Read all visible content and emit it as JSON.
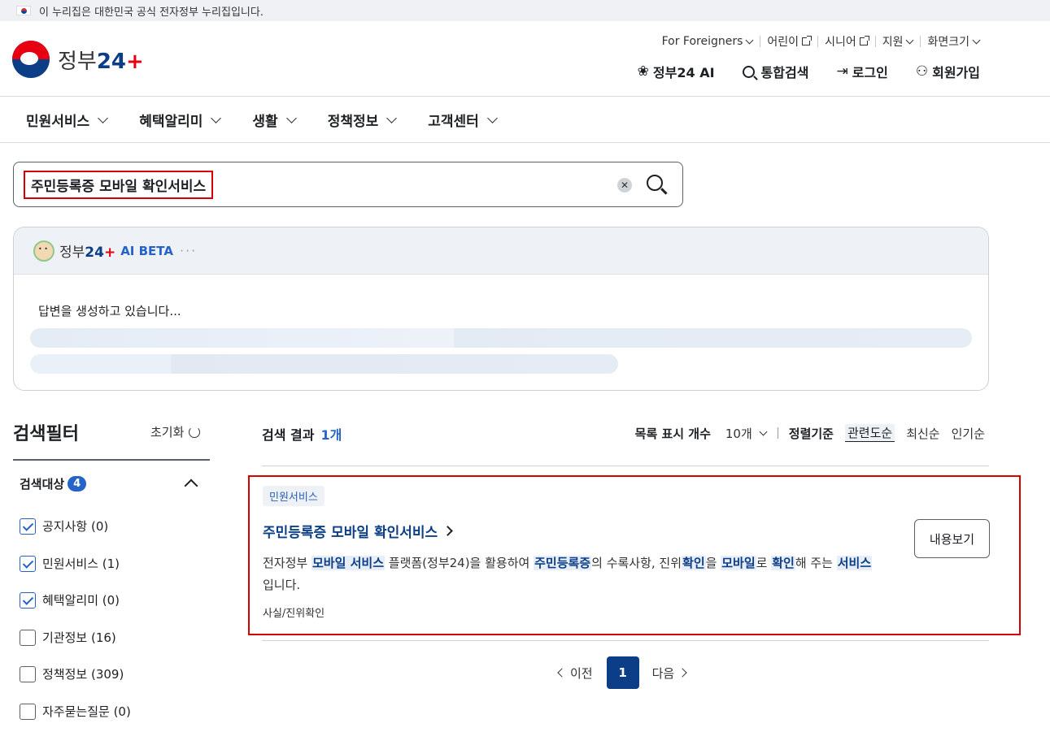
{
  "banner": {
    "text": "이 누리집은 대한민국 공식 전자정부 누리집입니다."
  },
  "logo": {
    "text_main": "정부",
    "text_num": "24",
    "text_plus": "+"
  },
  "util_nav": [
    {
      "label": "For Foreigners"
    },
    {
      "label": "어린이"
    },
    {
      "label": "시니어"
    },
    {
      "label": "지원"
    },
    {
      "label": "화면크기"
    }
  ],
  "main_util": {
    "ai": "정부24 AI",
    "search": "통합검색",
    "login": "로그인",
    "signup": "회원가입"
  },
  "gnb": [
    "민원서비스",
    "혜택알리미",
    "생활",
    "정책정보",
    "고객센터"
  ],
  "search": {
    "value": "주민등록증 모바일 확인서비스"
  },
  "ai_panel": {
    "brand_main": "정부",
    "brand_num": "24",
    "beta": "AI BETA",
    "dots": "···",
    "status": "답변을 생성하고 있습니다..."
  },
  "filter": {
    "title": "검색필터",
    "reset": "초기화",
    "target_label": "검색대상",
    "target_count": "4",
    "options": [
      {
        "label": "공지사항 (0)",
        "checked": true
      },
      {
        "label": "민원서비스 (1)",
        "checked": true
      },
      {
        "label": "혜택알리미 (0)",
        "checked": true
      },
      {
        "label": "기관정보 (16)",
        "checked": false
      },
      {
        "label": "정책정보 (309)",
        "checked": false
      },
      {
        "label": "자주묻는질문 (0)",
        "checked": false
      }
    ]
  },
  "results": {
    "title": "검색 결과",
    "count": "1개",
    "list_size_label": "목록 표시 개수",
    "list_size_value": "10개",
    "sort_label": "정렬기준",
    "sort_options": [
      "관련도순",
      "최신순",
      "인기순"
    ],
    "items": [
      {
        "tag": "민원서비스",
        "title": "주민등록증 모바일 확인서비스",
        "desc_parts": [
          {
            "t": "전자정부 ",
            "hl": false
          },
          {
            "t": "모바일 서비스",
            "hl": true
          },
          {
            "t": " 플랫폼(정부24)을 활용하여 ",
            "hl": false
          },
          {
            "t": "주민등록증",
            "hl": true
          },
          {
            "t": "의 수록사항, 진위",
            "hl": false
          },
          {
            "t": "확인",
            "hl": true
          },
          {
            "t": "을 ",
            "hl": false
          },
          {
            "t": "모바일",
            "hl": true
          },
          {
            "t": "로 ",
            "hl": false
          },
          {
            "t": "확인",
            "hl": true
          },
          {
            "t": "해 주는 ",
            "hl": false
          },
          {
            "t": "서비스",
            "hl": true
          },
          {
            "t": " 입니다.",
            "hl": false
          }
        ],
        "category": "사실/진위확인",
        "button": "내용보기"
      }
    ]
  },
  "pagination": {
    "prev": "이전",
    "current": "1",
    "next": "다음"
  },
  "colors": {
    "primary": "#0b3e86",
    "accent": "#2563c9",
    "highlight_box": "#d60000"
  }
}
